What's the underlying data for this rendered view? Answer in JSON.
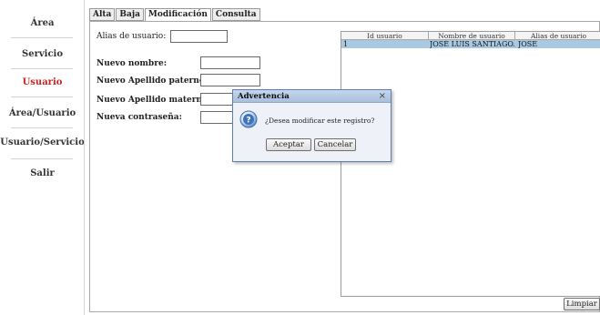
{
  "sidebar": {
    "items": [
      {
        "label": "Área",
        "active": false
      },
      {
        "label": "Servicio",
        "active": false
      },
      {
        "label": "Usuario",
        "active": true
      },
      {
        "label": "Área/Usuario",
        "active": false
      },
      {
        "label": "Usuario/Servicio",
        "active": false
      },
      {
        "label": "Salir",
        "active": false
      }
    ]
  },
  "tabs": [
    {
      "label": "Alta",
      "active": false
    },
    {
      "label": "Baja",
      "active": false
    },
    {
      "label": "Modificación",
      "active": true
    },
    {
      "label": "Consulta",
      "active": false
    }
  ],
  "form": {
    "alias_label": "Alias de usuario:",
    "alias_value": "",
    "nombre_label": "Nuevo nombre:",
    "nombre_value": "",
    "paterno_label": "Nuevo Apellido paterno:",
    "paterno_value": "",
    "materno_label": "Nuevo Apellido materno:",
    "materno_value": "",
    "password_label": "Nueva contraseña:",
    "password_value": ""
  },
  "table": {
    "headers": [
      "Id usuario",
      "Nombre de usuario",
      "Alias de usuario"
    ],
    "rows": [
      {
        "id": "1",
        "nombre": "JOSÉ LUIS SANTIAGO...",
        "alias": "JOSE",
        "selected": true
      }
    ]
  },
  "buttons": {
    "limpiar": "Limpiar"
  },
  "dialog": {
    "title": "Advertencia",
    "close": "×",
    "message": "¿Desea modificar este registro?",
    "accept": "Aceptar",
    "cancel": "Cancelar",
    "icon": "question-icon"
  },
  "colors": {
    "active_nav": "#cc2222",
    "selected_row": "#a9c8e2",
    "dialog_title": "#b7cbe5"
  }
}
